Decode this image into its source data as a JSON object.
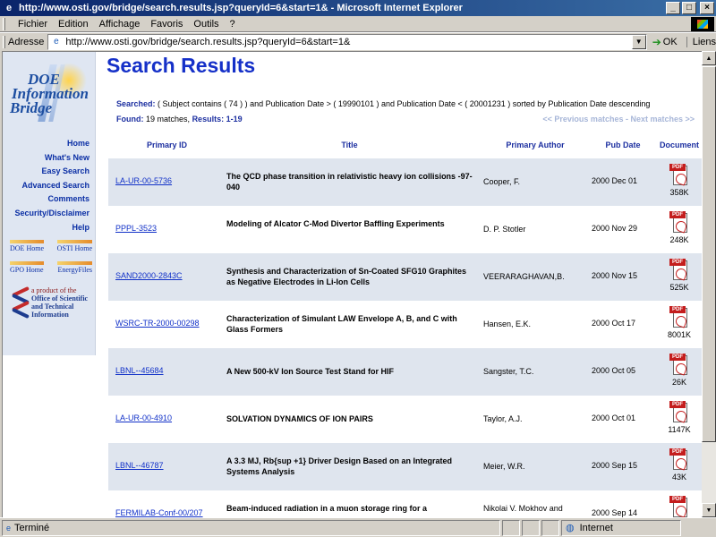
{
  "window": {
    "title": "http://www.osti.gov/bridge/search.results.jsp?queryId=6&start=1& - Microsoft Internet Explorer",
    "min": "_",
    "max": "□",
    "close": "×"
  },
  "menu": {
    "items": [
      "Fichier",
      "Edition",
      "Affichage",
      "Favoris",
      "Outils",
      "?"
    ]
  },
  "address": {
    "label": "Adresse",
    "url": "http://www.osti.gov/bridge/search.results.jsp?queryId=6&start=1&",
    "go": "OK",
    "links": "Liens"
  },
  "sidebar": {
    "logo": [
      "DOE",
      "Information",
      "Bridge"
    ],
    "nav": [
      "Home",
      "What's New",
      "Easy Search",
      "Advanced Search",
      "Comments",
      "Security/Disclaimer",
      "Help"
    ],
    "mini": [
      "DOE Home",
      "OSTI Home",
      "GPO Home",
      "EnergyFiles"
    ],
    "product": [
      "a product of the",
      "Office of Scientific",
      "and Technical",
      "Information"
    ]
  },
  "main": {
    "title": "Search Results",
    "searched_label": "Searched:",
    "searched_text": "( Subject contains ( 74 ) ) and Publication Date > ( 19990101 ) and Publication Date < ( 20001231 ) sorted by Publication Date descending",
    "found_label": "Found:",
    "found_text": "19 matches,",
    "results_label": "Results:",
    "results_text": "1-19",
    "pager": "<< Previous matches - Next matches >>",
    "headers": [
      "Primary ID",
      "Title",
      "Primary Author",
      "Pub Date",
      "Document"
    ],
    "pdf_label": "PDF",
    "rows": [
      {
        "id": "LA-UR-00-5736",
        "title": "The QCD phase transition in relativistic heavy ion collisions -97-040",
        "author": "Cooper, F.",
        "date": "2000 Dec 01",
        "size": "358K"
      },
      {
        "id": "PPPL-3523",
        "title": "Modeling of Alcator C-Mod Divertor Baffling Experiments",
        "author": "D. P. Stotler",
        "date": "2000 Nov 29",
        "size": "248K"
      },
      {
        "id": "SAND2000-2843C",
        "title": "Synthesis and Characterization of Sn-Coated SFG10 Graphites as Negative Electrodes in Li-Ion Cells",
        "author": "VEERARAGHAVAN,B.",
        "date": "2000 Nov 15",
        "size": "525K"
      },
      {
        "id": "WSRC-TR-2000-00298",
        "title": "Characterization of Simulant LAW Envelope A, B, and C with Glass Formers",
        "author": "Hansen, E.K.",
        "date": "2000 Oct 17",
        "size": "8001K"
      },
      {
        "id": "LBNL--45684",
        "title": "A New 500-kV Ion Source Test Stand for HIF",
        "author": "Sangster, T.C.",
        "date": "2000 Oct 05",
        "size": "26K"
      },
      {
        "id": "LA-UR-00-4910",
        "title": "SOLVATION DYNAMICS OF ION PAIRS",
        "author": "Taylor, A.J.",
        "date": "2000 Oct 01",
        "size": "1147K"
      },
      {
        "id": "LBNL--46787",
        "title": "A 3.3 MJ, Rb{sup +1} Driver Design Based on an Integrated Systems Analysis",
        "author": "Meier, W.R.",
        "date": "2000 Sep 15",
        "size": "43K"
      },
      {
        "id": "FERMILAB-Conf-00/207",
        "title": "Beam-induced radiation in a muon storage ring for a",
        "author": "Nikolai V. Mokhov and",
        "date": "2000 Sep 14",
        "size": ""
      }
    ]
  },
  "status": {
    "text": "Terminé",
    "zone": "Internet"
  }
}
